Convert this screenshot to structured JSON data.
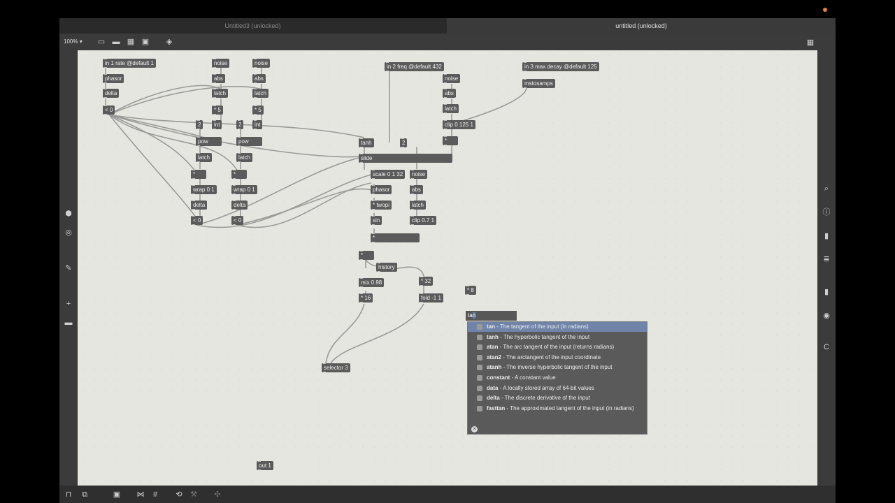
{
  "tabs": [
    {
      "label": "Untitled3 (unlocked)"
    },
    {
      "label": "untitled (unlocked)"
    }
  ],
  "toolbar": {
    "zoom": "100%"
  },
  "objects": {
    "in1": "in 1 rate @default 1",
    "phasor1": "phasor",
    "delta1": "delta",
    "lt1": "< 0",
    "noise1": "noise",
    "abs1": "abs",
    "latch1": "latch",
    "mul5a": "* 5",
    "two1": "2",
    "int1": "int",
    "pow1": "pow",
    "latch2": "latch",
    "mul1": "*",
    "wrap1": "wrap 0 1",
    "delta2": "delta",
    "lt2": "< 0",
    "noise2": "noise",
    "abs2": "abs",
    "latch3": "latch",
    "mul5b": "* 5",
    "two2": "2",
    "int2": "int",
    "pow2": "pow",
    "latch4": "latch",
    "mul2": "*",
    "wrap2": "wrap 0 1",
    "delta3": "delta",
    "lt3": "< 0",
    "in2": "in 2 freq @default 432",
    "noise3": "noise",
    "abs3": "abs",
    "latch5": "latch",
    "clip1": "clip 0 125 1",
    "mul3": "*",
    "in3": "in 3 max decay @default 125",
    "mstosamps": "mstosamps",
    "tanh": "tanh",
    "two3": "2",
    "slide": "slide",
    "scale": "scale 0 1 32",
    "noise4": "noise",
    "phasor2": "phasor",
    "abs4": "abs",
    "twopi": "* twopi",
    "latch6": "latch",
    "sin": "sin",
    "clip2": "clip 0.7 1",
    "mul4": "*",
    "mul6": "*",
    "history": "history",
    "mix": "mix 0.98",
    "mul32": "* 32",
    "mul16": "* 16",
    "fold": "fold -1 1",
    "mul8": "* 8",
    "selector": "selector 3",
    "out1": "out 1"
  },
  "editor": {
    "typing_prefix": "ta",
    "typing_selected": "n"
  },
  "suggestions": [
    {
      "name": "tan",
      "desc": " - The tangent of the input (in radians)"
    },
    {
      "name": "tanh",
      "desc": " - The hyperbolic tangent of the input"
    },
    {
      "name": "atan",
      "desc": " - The arc tangent of the input (returns radians)"
    },
    {
      "name": "atan2",
      "desc": " - The arctangent of the input coordinate"
    },
    {
      "name": "atanh",
      "desc": " - The inverse hyperbolic tangent of the input"
    },
    {
      "name": "constant",
      "desc": " - A constant value"
    },
    {
      "name": "data",
      "desc": " - A locally stored array of 64-bit values"
    },
    {
      "name": "delta",
      "desc": " - The discrete derivative of the input"
    },
    {
      "name": "fasttan",
      "desc": " - The approximated tangent of the input (in radians)"
    }
  ],
  "colors": {
    "canvas": "#e6e6e1",
    "object": "#5b5b5b",
    "selection": "#6f84a8",
    "cord": "#9a9a98",
    "recording": "#e8813a"
  },
  "icons": {
    "toolbar": [
      "present-icon",
      "comment-icon",
      "grid-icon",
      "image-icon",
      "paint-bucket-icon",
      "keyboard-icon"
    ],
    "left": [
      "package-icon",
      "target-icon",
      "paperclip-icon",
      "plus-icon",
      "minus-icon"
    ],
    "right": [
      "search-icon",
      "info-icon",
      "book-icon",
      "list-icon",
      "reference-icon",
      "camera-icon",
      "c-icon"
    ],
    "bottom": [
      "lock-icon",
      "edit-icon",
      "layers-icon",
      "pin-icon",
      "grid-icon",
      "loop-icon",
      "hammer-icon",
      "debug-icon"
    ]
  }
}
